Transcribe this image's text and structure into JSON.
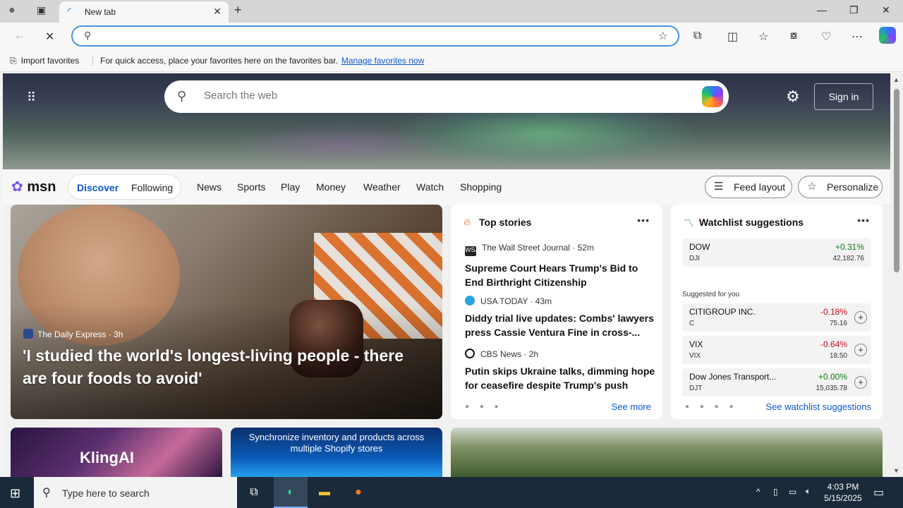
{
  "browser": {
    "tab_title": "New tab",
    "address_value": "",
    "favbar": {
      "import_label": "Import favorites",
      "message": "For quick access, place your favorites here on the favorites bar.",
      "manage_link": "Manage favorites now"
    }
  },
  "hero": {
    "search_placeholder": "Search the web",
    "signin_label": "Sign in"
  },
  "msn": {
    "logo": "msn",
    "pill_tabs": [
      "Discover",
      "Following"
    ],
    "nav": [
      "News",
      "Sports",
      "Play",
      "Money",
      "Weather",
      "Watch",
      "Shopping"
    ],
    "feed_layout_label": "Feed layout",
    "personalize_label": "Personalize"
  },
  "main_story": {
    "source": "The Daily Express · 3h",
    "headline": "'I studied the world's longest-living people - there are four foods to avoid'"
  },
  "top_stories": {
    "title": "Top stories",
    "items": [
      {
        "source": "The Wall Street Journal · 52m",
        "logo": "WSJ",
        "headline": "Supreme Court Hears Trump's Bid to End Birthright Citizenship"
      },
      {
        "source": "USA TODAY · 43m",
        "logo": "",
        "headline": "Diddy trial live updates: Combs' lawyers press Cassie Ventura Fine in cross-..."
      },
      {
        "source": "CBS News · 2h",
        "logo": "",
        "headline": "Putin skips Ukraine talks, dimming hope for ceasefire despite Trump's push"
      }
    ],
    "see_more": "See more"
  },
  "watchlist": {
    "title": "Watchlist suggestions",
    "featured": {
      "name": "DOW",
      "symbol": "DJI",
      "change": "+0.31%",
      "price": "42,182.76"
    },
    "suggested_label": "Suggested for you",
    "suggested": [
      {
        "name": "CITIGROUP INC.",
        "symbol": "C",
        "change": "-0.18%",
        "price": "75.16"
      },
      {
        "name": "VIX",
        "symbol": "VIX",
        "change": "-0.64%",
        "price": "18.50"
      },
      {
        "name": "Dow Jones Transport...",
        "symbol": "DJT",
        "change": "+0.00%",
        "price": "15,035.78"
      }
    ],
    "see_more": "See watchlist suggestions"
  },
  "bottom_cards": {
    "kling": "KlingAI",
    "shopify": "Synchronize inventory and products across multiple Shopify stores"
  },
  "taskbar": {
    "search_placeholder": "Type here to search",
    "time": "4:03 PM",
    "date": "5/15/2025"
  },
  "colors": {
    "accent": "#0b57d0",
    "up": "#107c10",
    "down": "#c50f1f"
  }
}
